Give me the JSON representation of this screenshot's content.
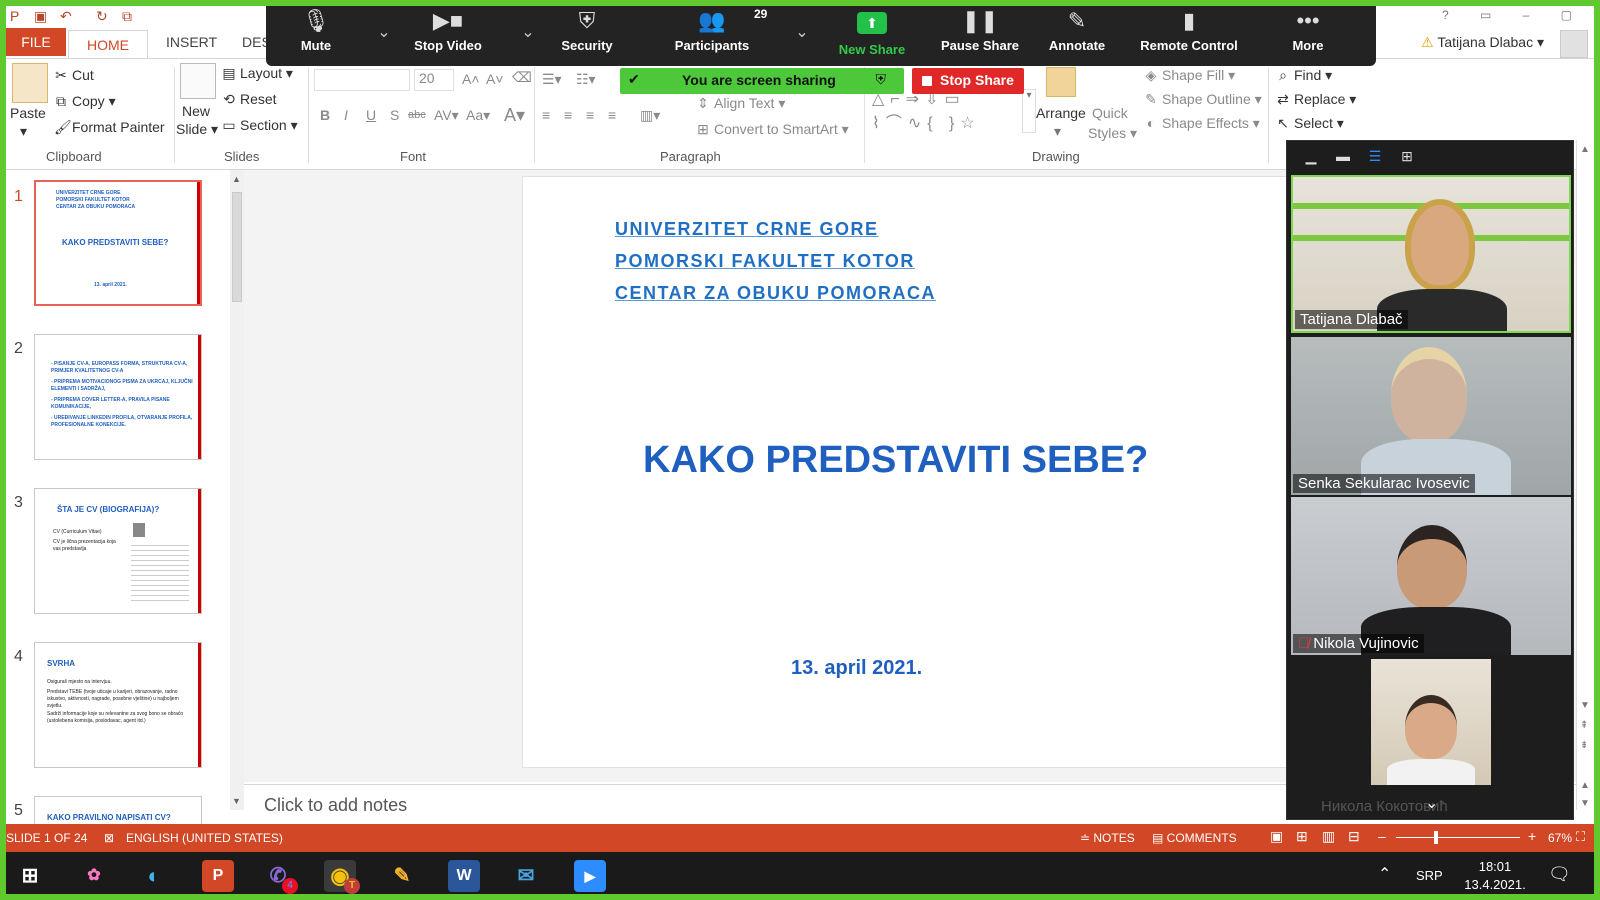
{
  "ppt": {
    "tabs": [
      "FILE",
      "HOME",
      "INSERT",
      "DESI"
    ],
    "user": "Tatijana Dlabac",
    "clipboard": {
      "paste": "Paste",
      "cut": "Cut",
      "copy": "Copy",
      "format_painter": "Format Painter",
      "label": "Clipboard"
    },
    "slides_group": {
      "new_slide_1": "New",
      "new_slide_2": "Slide",
      "layout": "Layout",
      "reset": "Reset",
      "section": "Section",
      "label": "Slides"
    },
    "font_group": {
      "size": "20",
      "label": "Font"
    },
    "paragraph_group": {
      "align_text": "Align Text",
      "convert_smartart": "Convert to SmartArt",
      "label": "Paragraph"
    },
    "drawing_group": {
      "arrange": "Arrange",
      "quick_styles_1": "Quick",
      "quick_styles_2": "Styles",
      "shape_fill": "Shape Fill",
      "shape_outline": "Shape Outline",
      "shape_effects": "Shape Effects",
      "label": "Drawing"
    },
    "editing_group": {
      "find": "Find",
      "replace": "Replace",
      "select": "Select"
    },
    "thumbnails": [
      {
        "num": "1",
        "lines": [
          "UNIVERZITET CRNE GORE",
          "POMORSKI FAKULTET KOTOR",
          "CENTAR ZA OBUKU POMORACA"
        ],
        "title": "KAKO PREDSTAVITI SEBE?",
        "date": "13. april 2021."
      },
      {
        "num": "2",
        "bullets": [
          "- PISANJE CV-A, EUROPASS FORMA, STRUKTURA CV-A, PRIMJER KVALITETNOG CV-A",
          "- PRIPREMA MOTIVACIONOG PISMA ZA UKRCAJ, KLJUČNI ELEMENTI I SADRŽAJ,",
          "- PRIPREMA COVER LETTER-A, PRAVILA PISANE KOMUNIKACIJE,",
          "- UREĐIVANJE LINKEDIN PROFILA, OTVARANJE PROFILA, PROFESIONALNE KONEKCIJE."
        ]
      },
      {
        "num": "3",
        "title": "ŠTA JE CV (BIOGRAFIJA)?",
        "bullets": [
          "CV (Curriculum Vitae)",
          "CV je lična prezentacija koja vas predstavlja"
        ]
      },
      {
        "num": "4",
        "title": "SVRHA",
        "bullets": [
          "Osiguraš mjesto na intervjuu.",
          "Predstavi TEBE (tvoje uticaje u karijeri, obrazovanje, radno iskustvo, aktivnosti, nagrade, posebne vještine) u najboljem svjetlu.",
          "Sadrži informacije koje su relevantne za svog bono se obraćo (ustolebena komisija, poslodavac, agent itd.)"
        ]
      },
      {
        "num": "5",
        "title": "KAKO PRAVILNO NAPISATI CV?"
      }
    ],
    "slide": {
      "line1": "UNIVERZITET CRNE GORE",
      "line2": "POMORSKI FAKULTET KOTOR",
      "line3": "CENTAR ZA OBUKU POMORACA",
      "title": "KAKO PREDSTAVITI SEBE?",
      "date": "13. april 2021."
    },
    "notes_placeholder": "Click to add notes",
    "status": {
      "slide": "SLIDE 1 OF 24",
      "language": "ENGLISH (UNITED STATES)",
      "notes": "NOTES",
      "comments": "COMMENTS",
      "zoom": "67%"
    }
  },
  "zoom": {
    "toolbar": {
      "mute": "Mute",
      "stop_video": "Stop Video",
      "security": "Security",
      "participants": "Participants",
      "participant_count": "29",
      "new_share": "New Share",
      "pause_share": "Pause Share",
      "annotate": "Annotate",
      "remote_control": "Remote Control",
      "more": "More"
    },
    "banner": "You are screen sharing",
    "stop_share": "Stop Share",
    "participants": [
      {
        "name": "Tatijana Dlabač"
      },
      {
        "name": "Senka Sekularac Ivosevic"
      },
      {
        "name": "Nikola Vujinovic"
      },
      {
        "name": "Никола Кокотовић"
      }
    ]
  },
  "taskbar": {
    "viber_badge": "4",
    "chrome_badge": "T",
    "language": "SRP",
    "time": "18:01",
    "date": "13.4.2021."
  },
  "colors": {
    "ppt_accent": "#d24726",
    "slide_blue": "#1f5fbf",
    "share_green": "#4cc83a",
    "stop_red": "#e02828"
  }
}
